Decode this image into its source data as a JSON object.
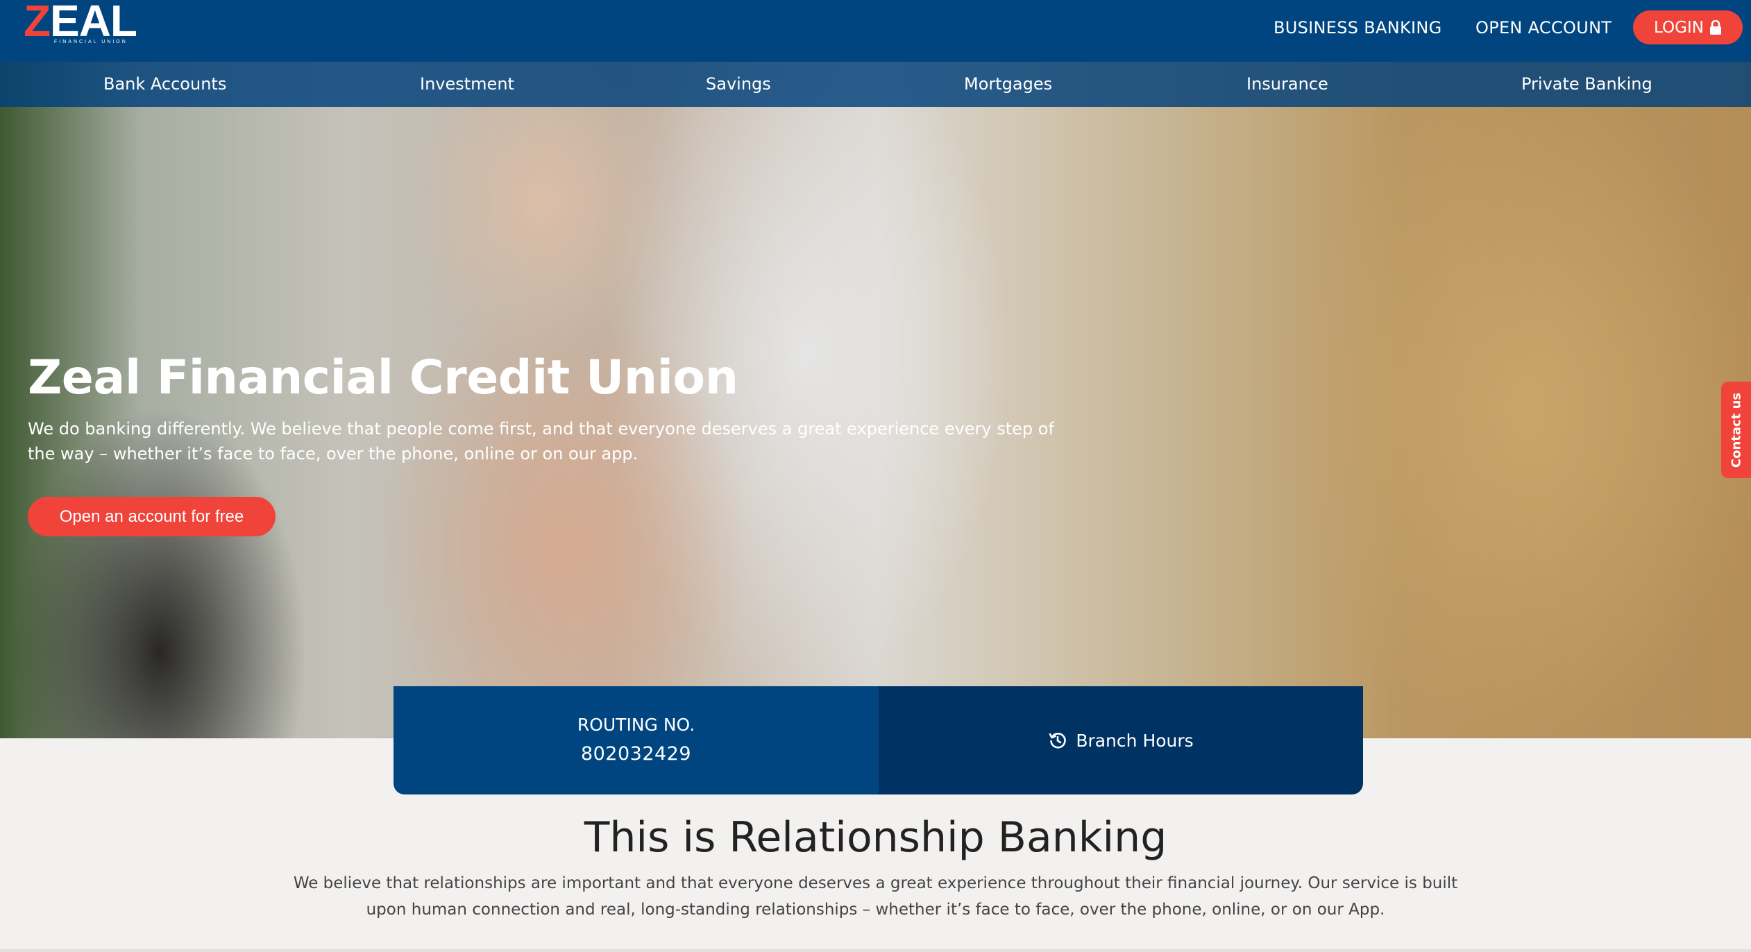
{
  "brand": {
    "logo_letter_z": "Z",
    "logo_letters": "EAL",
    "logo_subtext": "FINANCIAL UNION"
  },
  "header": {
    "links": [
      "BUSINESS BANKING",
      "OPEN ACCOUNT"
    ],
    "login_label": "LOGIN",
    "login_icon": "lock-icon"
  },
  "subnav": {
    "items": [
      "Bank Accounts",
      "Investment",
      "Savings",
      "Mortgages",
      "Insurance",
      "Private Banking"
    ]
  },
  "hero": {
    "title": "Zeal Financial Credit Union",
    "text": "We do banking differently. We believe that people come first, and that everyone deserves a great experience every step of the way – whether it’s face to face, over the phone, online or on our app.",
    "cta_label": "Open an account for free"
  },
  "contact_tab": {
    "label": "Contact us"
  },
  "info_bar": {
    "routing_label": "ROUTING NO.",
    "routing_number": "802032429",
    "hours_label": "Branch Hours",
    "hours_icon": "history-icon"
  },
  "section": {
    "title": "This is Relationship Banking",
    "text": "We believe that relationships are important and that everyone deserves a great experience throughout their financial journey. Our service is built upon human connection and real, long-standing relationships – whether it’s face to face, over the phone, online, or on our App."
  },
  "colors": {
    "primary": "#00457f",
    "primary_dark": "#003263",
    "accent": "#f0433a",
    "background": "#f3f1f0"
  }
}
